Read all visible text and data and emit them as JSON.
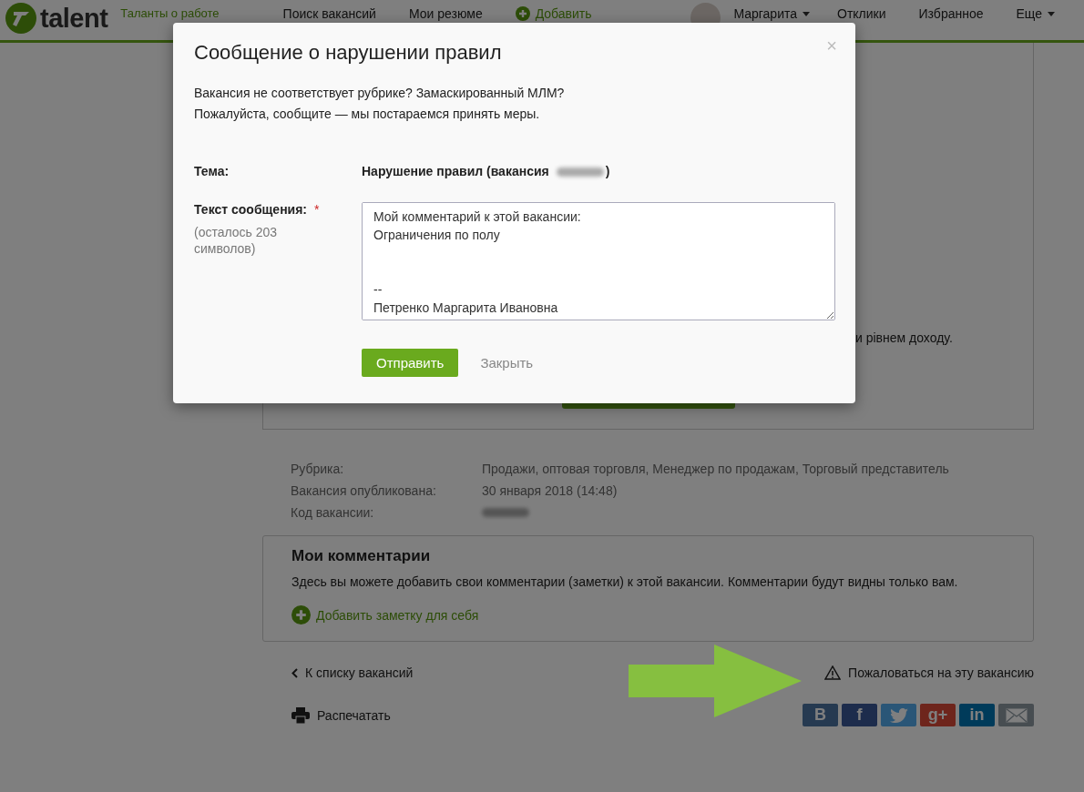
{
  "header": {
    "logo_text": "talent",
    "tagline": "Таланты о работе",
    "nav": [
      {
        "kind": "link",
        "label": "Поиск вакансий"
      },
      {
        "kind": "link",
        "label": "Мои резюме"
      },
      {
        "kind": "add",
        "label": "Добавить"
      },
      {
        "kind": "user",
        "label": "Маргарита"
      },
      {
        "kind": "link",
        "label": "Отклики"
      },
      {
        "kind": "link",
        "label": "Избранное"
      },
      {
        "kind": "dropdown",
        "label": "Еще"
      }
    ]
  },
  "card_fragment": "и рівнем доходу.",
  "details": [
    {
      "label": "Рубрика:",
      "value": "Продажи, оптовая торговля,  Менеджер по продажам,  Торговый представитель"
    },
    {
      "label": "Вакансия опубликована:",
      "value": "30 января 2018 (14:48)"
    },
    {
      "label": "Код вакансии:",
      "redacted": true
    }
  ],
  "comments": {
    "title": "Мои комментарии",
    "text": "Здесь вы можете добавить свои комментарии (заметки) к этой вакансии. Комментарии будут видны только вам.",
    "add_link": "Добавить заметку для себя"
  },
  "footer": {
    "back_link": "К списку вакансий",
    "report_link": "Пожаловаться на эту вакансию",
    "print_link": "Распечатать",
    "share": [
      {
        "kind": "vk",
        "label": "B"
      },
      {
        "kind": "facebook",
        "label": "f"
      },
      {
        "kind": "twitter"
      },
      {
        "kind": "google",
        "label": "g+"
      },
      {
        "kind": "linkedin",
        "label": "in"
      },
      {
        "kind": "email"
      }
    ]
  },
  "modal": {
    "title": "Сообщение о нарушении правил",
    "close": "×",
    "intro": [
      "Вакансия не соответствует рубрике? Замаскированный МЛМ?",
      "Пожалуйста, сообщите — мы постараемся принять меры."
    ],
    "subject_label": "Тема:",
    "subject_value": "Нарушение правил (вакансия",
    "subject_tail": ")",
    "message_label": "Текст сообщения:",
    "required_mark": "*",
    "hint": "(осталось 203 символов)",
    "message_lines": [
      "Мой комментарий к этой вакансии:",
      "Ограничения по полу"
    ],
    "signature_lines": [
      "--",
      "Петренко Маргарита Ивановна"
    ],
    "buttons": [
      {
        "kind": "primary",
        "label": "Отправить"
      },
      {
        "kind": "plain",
        "label": "Закрыть"
      }
    ]
  }
}
